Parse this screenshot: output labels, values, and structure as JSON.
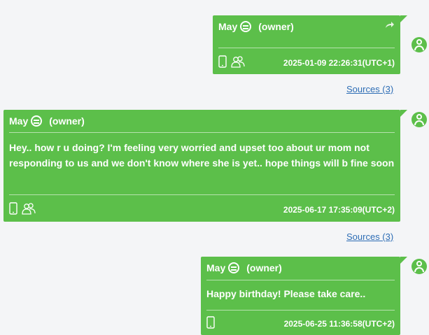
{
  "messages": [
    {
      "sender": "May",
      "role": "(owner)",
      "text": "",
      "timestamp": "2025-01-09 22:26:31(UTC+1)",
      "forwarded": true,
      "icons": [
        "phone-icon",
        "group-icon"
      ]
    },
    {
      "sender": "May",
      "role": "(owner)",
      "text": "Hey.. how r u doing? I'm feeling very worried and upset too about ur mom not responding to us and we don't know where she is yet.. hope things will b fine soon",
      "timestamp": "2025-06-17 17:35:09(UTC+2)",
      "forwarded": false,
      "icons": [
        "phone-icon",
        "group-icon"
      ]
    },
    {
      "sender": "May",
      "role": "(owner)",
      "text": "Happy birthday! Please take care..",
      "timestamp": "2025-06-25 11:36:58(UTC+2)",
      "forwarded": false,
      "icons": [
        "phone-icon"
      ]
    }
  ],
  "sources_links": [
    "Sources (3)",
    "Sources (3)"
  ],
  "colors": {
    "bubble": "#5cbf4a",
    "link": "#2d6db5",
    "background": "#f4f5f7"
  }
}
